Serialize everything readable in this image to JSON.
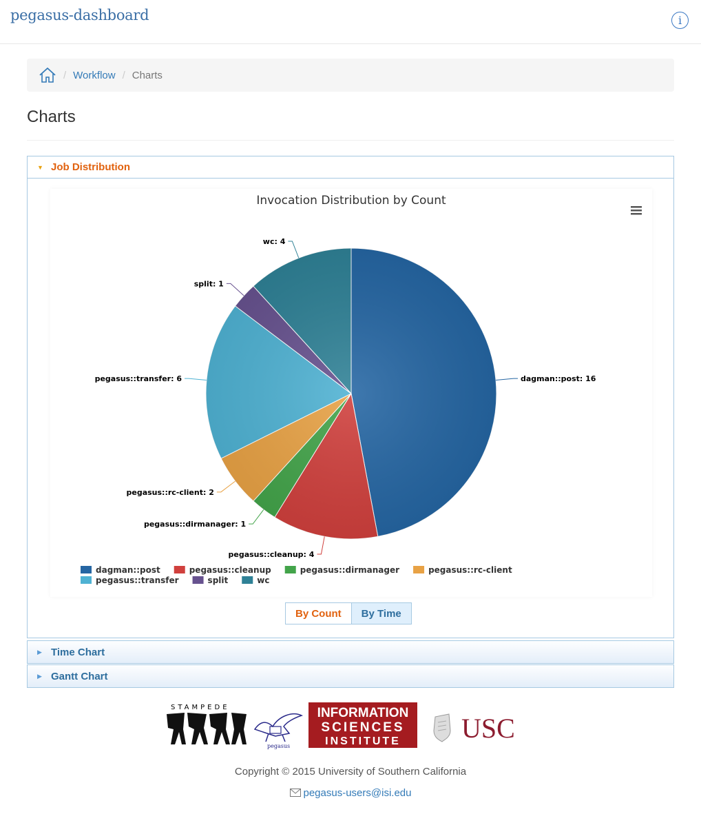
{
  "app": {
    "brand": "pegasus-dashboard",
    "info_glyph": "i"
  },
  "breadcrumb": {
    "items": [
      "Workflow",
      "Charts"
    ],
    "separator": "/"
  },
  "page_title": "Charts",
  "panels": {
    "job_distribution": "Job Distribution",
    "time_chart": "Time Chart",
    "gantt_chart": "Gantt Chart"
  },
  "toggle": {
    "by_count": "By Count",
    "by_time": "By Time"
  },
  "logos": {
    "stampede": "STAMPEDE",
    "pegasus": "pegasus",
    "isi": [
      "INFORMATION",
      "SCIENCES",
      "INSTITUTE"
    ],
    "usc": "USC"
  },
  "footer": {
    "copyright": "Copyright © 2015 University of Southern California",
    "email": "pegasus-users@isi.edu"
  },
  "colors": {
    "accent": "#e1620f",
    "link": "#337ab7",
    "panel_border": "#a6c9e2",
    "usc": "#8c1c2f",
    "isi": "#a51c20"
  },
  "icons": {
    "home": "home-icon",
    "menu": "hamburger-menu-icon",
    "info": "info-icon",
    "mail": "envelope-icon"
  },
  "chart_data": {
    "type": "pie",
    "title": "Invocation Distribution by Count",
    "categories": [
      "dagman::post",
      "pegasus::cleanup",
      "pegasus::dirmanager",
      "pegasus::rc-client",
      "pegasus::transfer",
      "split",
      "wc"
    ],
    "values": [
      16,
      4,
      1,
      2,
      6,
      1,
      4
    ],
    "colors": [
      "#2566a3",
      "#d0403d",
      "#43a44a",
      "#e8a245",
      "#4fb2d3",
      "#67528f",
      "#2f8196"
    ],
    "legend_position": "bottom"
  }
}
